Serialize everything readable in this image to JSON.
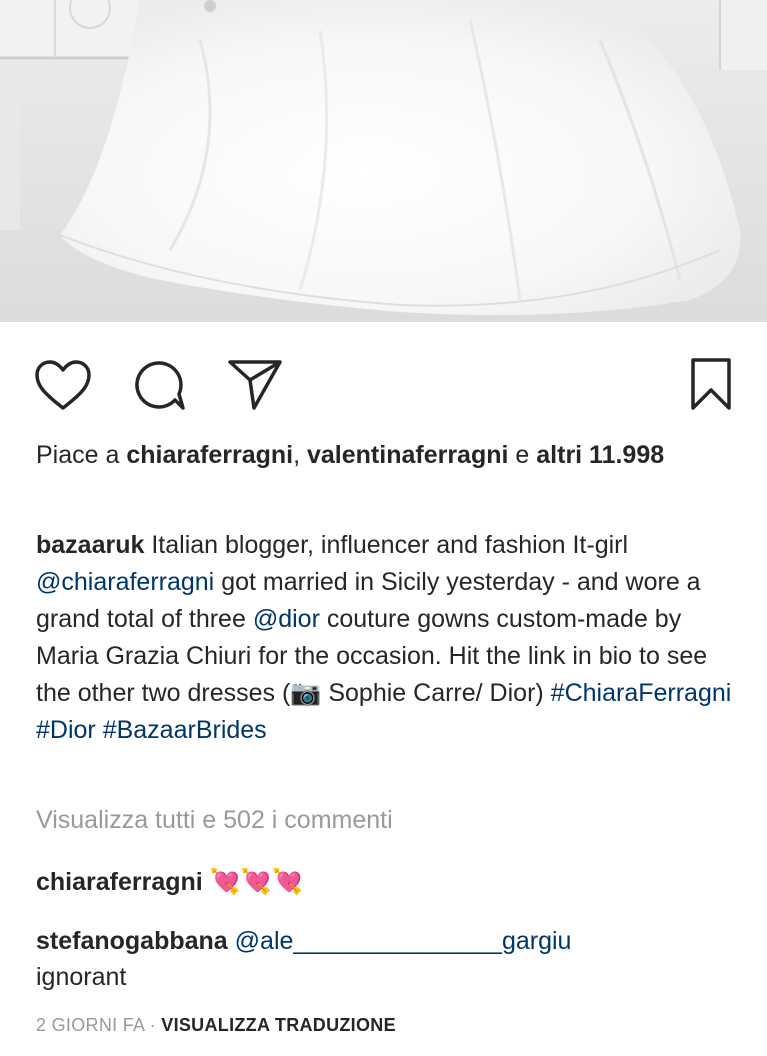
{
  "post": {
    "image_alt": "white bridal gown train on floor",
    "likes_prefix": "Piace a",
    "liker1": "chiaraferragni",
    "liker_sep": ",",
    "liker2": "valentinaferragni",
    "likes_and": "e",
    "likes_others": "altri 11.998",
    "caption": {
      "username": "bazaaruk",
      "text1": "Italian blogger, influencer and fashion It-girl",
      "mention1": "@chiaraferragni",
      "text2": "got married in Sicily yesterday - and wore a grand total of three",
      "mention2": "@dior",
      "text3": "couture gowns custom-made by Maria Grazia Chiuri for the occasion. Hit the link in bio to see the other two dresses (📷 Sophie Carre/ Dior)",
      "hashtag1": "#ChiaraFerragni",
      "hashtag2": "#Dior",
      "hashtag3": "#BazaarBrides"
    },
    "view_all_comments": "Visualizza tutti e 502 i commenti",
    "comments": [
      {
        "username": "chiaraferragni",
        "text": "💘💘💘"
      },
      {
        "username": "stefanogabbana",
        "mention": "@ale_______________gargiu",
        "text": "ignorant"
      }
    ],
    "time_ago": "2 GIORNI FA",
    "meta_separator": "·",
    "translate_label": "VISUALIZZA TRADUZIONE"
  },
  "icons": {
    "like": "heart-icon",
    "comment": "comment-bubble-icon",
    "share": "paper-plane-icon",
    "save": "bookmark-icon"
  },
  "colors": {
    "text": "#262626",
    "link": "#003569",
    "muted": "#999999"
  }
}
